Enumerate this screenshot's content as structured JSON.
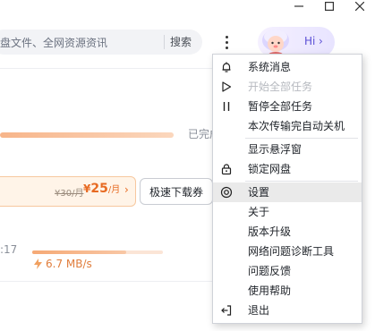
{
  "search": {
    "placeholder": "盘文件、全网资源资讯",
    "button_label": "搜索"
  },
  "avatar": {
    "greeting": "Hi",
    "chevron": "›"
  },
  "transfer": {
    "progress1": 1.0,
    "status_done": "已完成",
    "vip": {
      "old_price": "¥30/月",
      "new_price_symbol": "¥",
      "new_price": "25",
      "new_price_unit": "/月",
      "chevron": "›"
    },
    "ticket_button": "极速下载券",
    "row2_time": ":17",
    "progress2": 0.72,
    "speed": "6.7 MB/s"
  },
  "menu": {
    "items": [
      {
        "label": "系统消息",
        "icon": "bell-icon",
        "disabled": false
      },
      {
        "label": "开始全部任务",
        "icon": "play-icon",
        "disabled": true
      },
      {
        "label": "暂停全部任务",
        "icon": "pause-icon",
        "disabled": false
      },
      {
        "label": "本次传输完自动关机",
        "icon": "",
        "disabled": false
      },
      {
        "label": "显示悬浮窗",
        "icon": "",
        "disabled": false
      },
      {
        "label": "锁定网盘",
        "icon": "lock-icon",
        "disabled": false
      },
      {
        "label": "设置",
        "icon": "settings-icon",
        "disabled": false,
        "active": true
      },
      {
        "label": "关于",
        "icon": "",
        "disabled": false
      },
      {
        "label": "版本升级",
        "icon": "",
        "disabled": false
      },
      {
        "label": "网络问题诊断工具",
        "icon": "",
        "disabled": false
      },
      {
        "label": "问题反馈",
        "icon": "",
        "disabled": false
      },
      {
        "label": "使用帮助",
        "icon": "",
        "disabled": false
      },
      {
        "label": "退出",
        "icon": "exit-icon",
        "disabled": false
      }
    ]
  },
  "colors": {
    "accent_orange": "#e76a22",
    "brand_purple": "#5b4fd6",
    "hover_bg": "#eaeaea"
  }
}
